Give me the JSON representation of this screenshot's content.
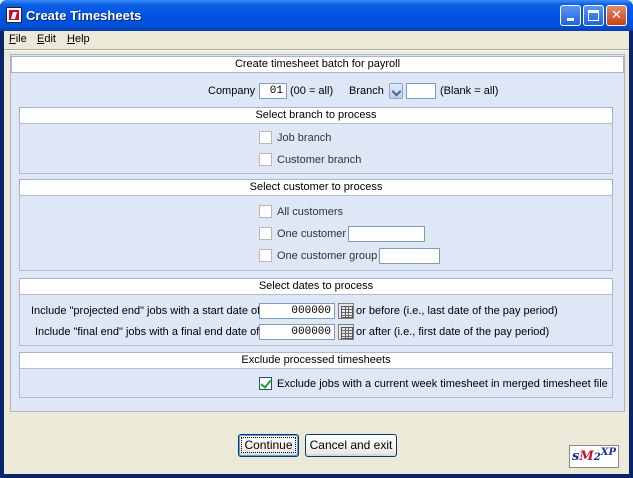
{
  "window": {
    "title": "Create Timesheets"
  },
  "menu": [
    {
      "label": "File",
      "accel": "F",
      "rest": "ile"
    },
    {
      "label": "Edit",
      "accel": "E",
      "rest": "dit"
    },
    {
      "label": "Help",
      "accel": "H",
      "rest": "elp"
    }
  ],
  "header_main": "Create timesheet batch for payroll",
  "company": {
    "label": "Company",
    "value": "01",
    "hint": "(00 = all)"
  },
  "branch": {
    "label": "Branch",
    "value": "",
    "hint": "(Blank = all)"
  },
  "branch_section": {
    "header": "Select branch to process",
    "options": [
      {
        "label": "Job branch",
        "checked": false
      },
      {
        "label": "Customer branch",
        "checked": false
      }
    ]
  },
  "customer_section": {
    "header": "Select customer to process",
    "all_label": "All customers",
    "one_label": "One customer",
    "one_value": "",
    "group_label": "One customer group",
    "group_value": ""
  },
  "dates_section": {
    "header": "Select dates to process",
    "row1_label": "Include \"projected end\" jobs with a start date of",
    "row1_value": "000000",
    "row1_suffix": "or before  (i.e., last date of the pay period)",
    "row2_label": "Include \"final end\" jobs with a final end date of",
    "row2_value": "000000",
    "row2_suffix": "or after  (i.e., first date of the pay period)"
  },
  "exclude_section": {
    "header": "Exclude processed timesheets",
    "option_label": "Exclude jobs with a current week timesheet in merged timesheet file",
    "checked": true
  },
  "buttons": {
    "continue": "Continue",
    "cancel": "Cancel and exit"
  },
  "logo": {
    "s": "s",
    "m": "M",
    "two": "2",
    "xp": "XP"
  },
  "colors": {
    "panel": "#DFE7F7",
    "titlebar": "#0054E3",
    "check": "#21A121"
  }
}
